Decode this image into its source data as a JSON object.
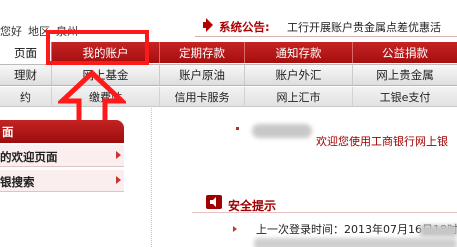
{
  "header": {
    "greeting": "您好",
    "region_label": "地区",
    "region_value": "泉州",
    "notice_title": "系统公告:",
    "notice_text": "工行开展账户贵金属点差优惠活"
  },
  "nav": {
    "row1": [
      {
        "label": "页面",
        "active": true
      },
      {
        "label": "我的账户",
        "active": false
      },
      {
        "label": "定期存款",
        "active": false
      },
      {
        "label": "通知存款",
        "active": false
      },
      {
        "label": "公益捐款",
        "active": false
      }
    ],
    "row2": [
      "理财",
      "网上基金",
      "账户原油",
      "账户外汇",
      "网上贵金属"
    ],
    "row3": [
      "约",
      "缴费站",
      "信用卡服务",
      "网上汇市",
      "工银e支付"
    ]
  },
  "sidebar": {
    "header": "面",
    "items": [
      "的欢迎页面",
      "银搜索"
    ]
  },
  "main": {
    "welcome": "欢迎您使用工商银行网上银",
    "security_title": "安全提示",
    "last_login": "上一次登录时间：2013年07月16日18时"
  },
  "annotation": {
    "highlight_color": "#ff1a1a",
    "highlight_target": "我的账户"
  },
  "colors": {
    "brand_red": "#b00000",
    "nav_red": "#c42424"
  },
  "icons": [
    "speaker-icon",
    "security-speaker-icon",
    "up-arrow-annotation-icon"
  ]
}
